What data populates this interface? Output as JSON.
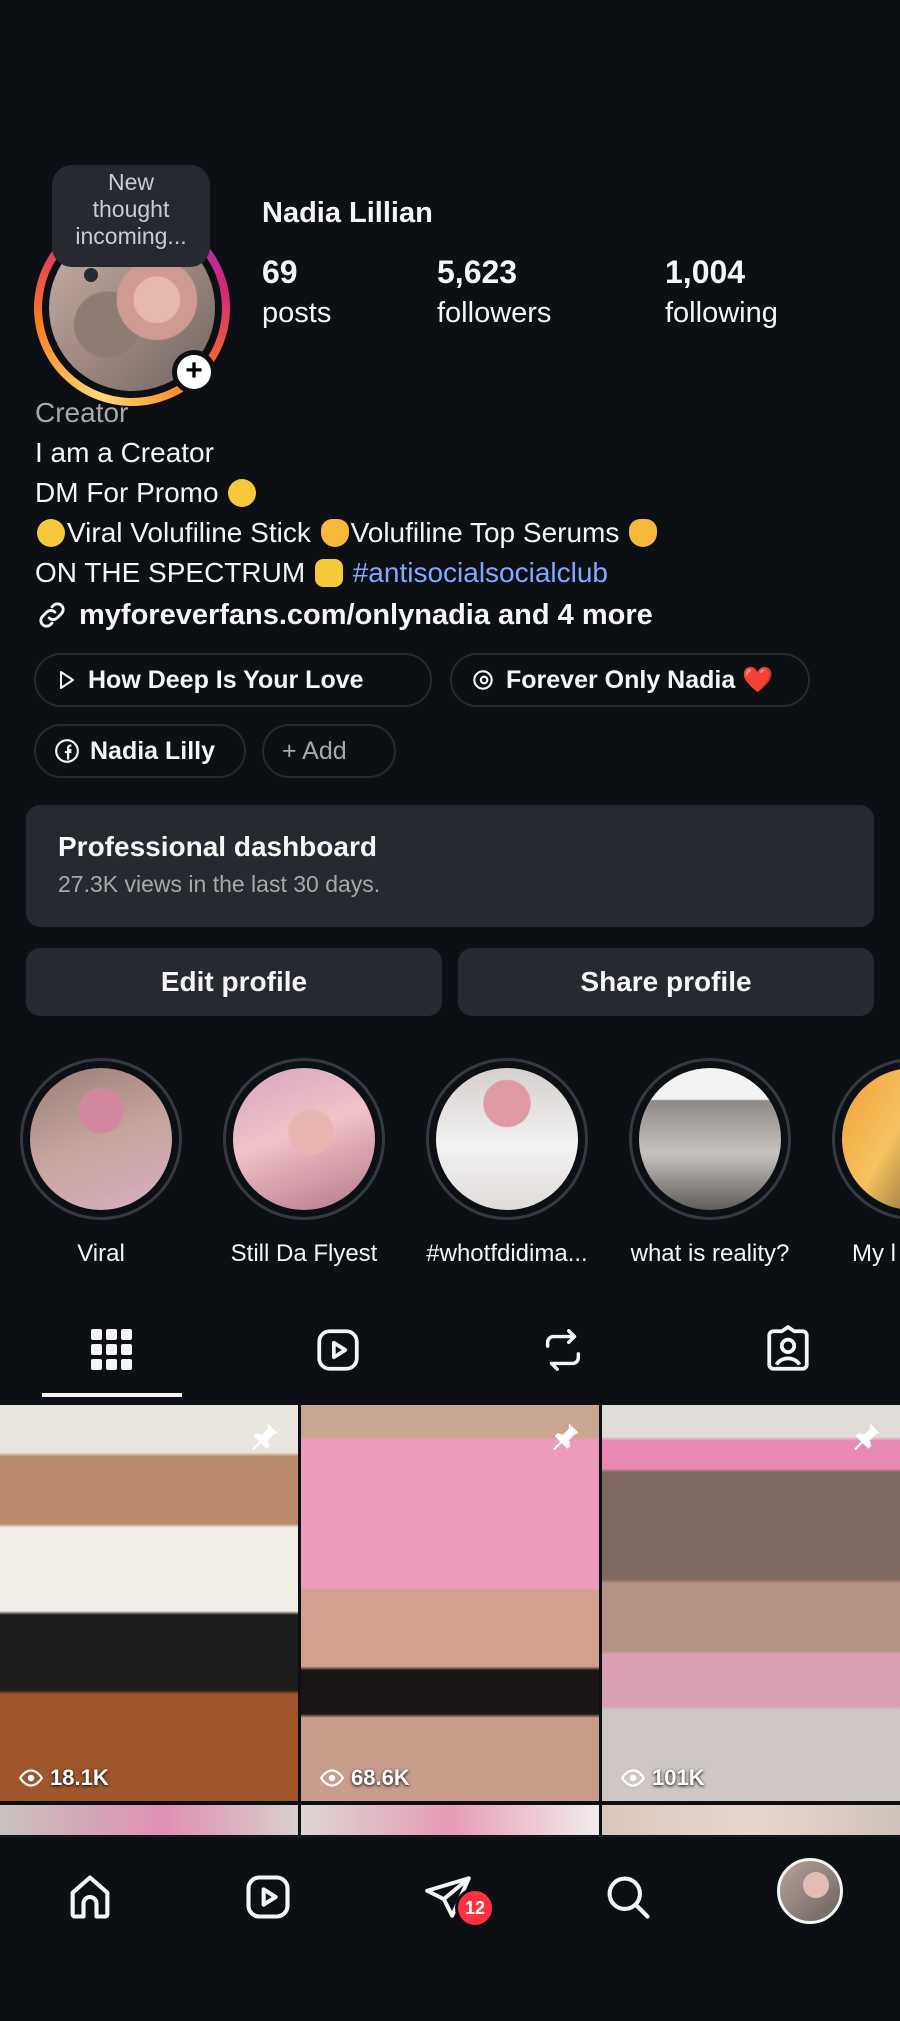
{
  "note": {
    "lines": [
      "New",
      "thought",
      "incoming..."
    ]
  },
  "profile": {
    "username": "Nadia Lillian",
    "stats": [
      {
        "value": "69",
        "label": "posts"
      },
      {
        "value": "5,623",
        "label": "followers"
      },
      {
        "value": "1,004",
        "label": "following"
      }
    ],
    "category": "Creator",
    "bio": {
      "line1": "I am a Creator",
      "line2": "DM For Promo",
      "line3a": "Viral Volufiline Stick",
      "line3b": "Volufiline Top Serums",
      "line4a": "ON THE SPECTRUM",
      "line4_tag": "#antisocialsocialclub"
    },
    "link": "myforeverfans.com/onlynadia and 4 more"
  },
  "pills": {
    "music": "How Deep Is Your Love",
    "threads": "Forever Only Nadia ❤️",
    "facebook": "Nadia Lilly",
    "add": "+ Add"
  },
  "dashboard": {
    "title": "Professional dashboard",
    "subtitle": "27.3K views in the last 30 days."
  },
  "buttons": {
    "edit": "Edit profile",
    "share": "Share profile"
  },
  "highlights": [
    {
      "label": "Viral"
    },
    {
      "label": "Still Da Flyest"
    },
    {
      "label": "#whotfdidima..."
    },
    {
      "label": "what is reality?"
    },
    {
      "label": "My l"
    }
  ],
  "posts": [
    {
      "views": "18.1K"
    },
    {
      "views": "68.6K"
    },
    {
      "views": "101K"
    }
  ],
  "nav": {
    "badge": "12"
  },
  "icons": {
    "tab_grid": "grid-icon",
    "tab_reels": "reels-icon",
    "tab_reposts": "repost-icon",
    "tab_tagged": "tagged-icon",
    "home": "home-icon",
    "reels": "reels-icon",
    "messages": "send-icon",
    "search": "search-icon"
  },
  "colors": {
    "background": "#0c1014",
    "surface": "#262a30",
    "hashtag": "#85a7ff",
    "badge": "#ff3040"
  }
}
